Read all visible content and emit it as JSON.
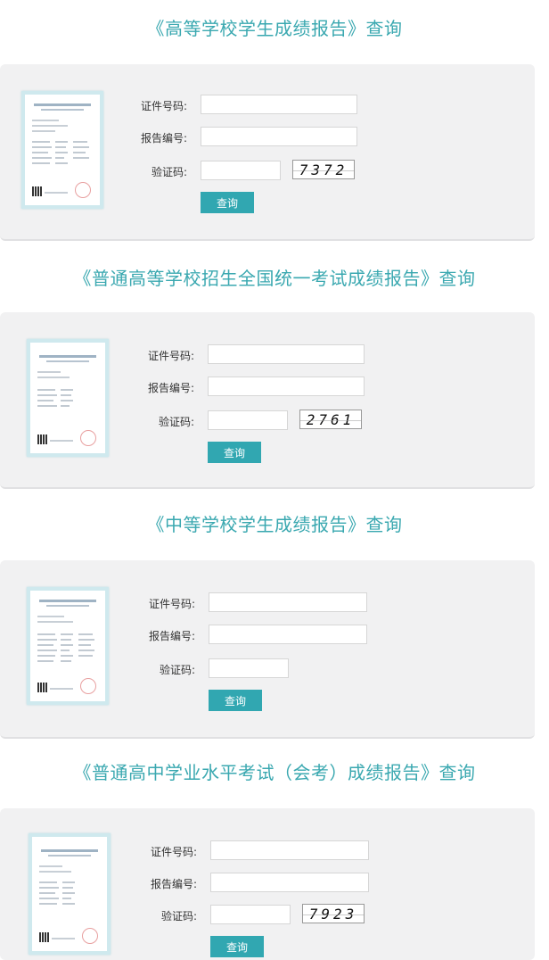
{
  "sections": [
    {
      "title": "《高等学校学生成绩报告》查询",
      "id_label": "证件号码:",
      "report_label": "报告编号:",
      "code_label": "验证码:",
      "captcha": "7372",
      "submit": "查询"
    },
    {
      "title": "《普通高等学校招生全国统一考试成绩报告》查询",
      "id_label": "证件号码:",
      "report_label": "报告编号:",
      "code_label": "验证码:",
      "captcha": "2761",
      "submit": "查询"
    },
    {
      "title": "《中等学校学生成绩报告》查询",
      "id_label": "证件号码:",
      "report_label": "报告编号:",
      "code_label": "验证码:",
      "captcha": "",
      "submit": "查询"
    },
    {
      "title": "《普通高中学业水平考试（会考）成绩报告》查询",
      "id_label": "证件号码:",
      "report_label": "报告编号:",
      "code_label": "验证码:",
      "captcha": "7923",
      "submit": "查询"
    }
  ],
  "colors": {
    "accent": "#31a7b1",
    "title": "#3aa8b0",
    "panel": "#f1f1f2"
  },
  "icons": {
    "report_thumbnail": "report-certificate-icon"
  }
}
